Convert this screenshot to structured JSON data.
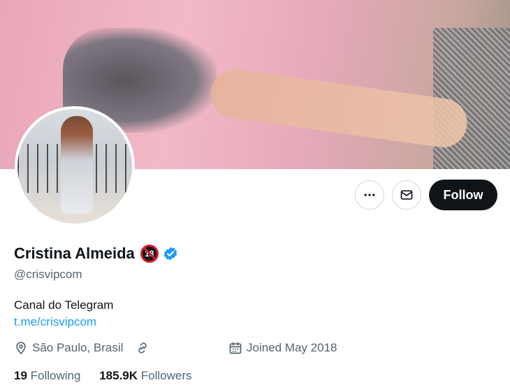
{
  "profile": {
    "display_name": "Cristina Almeida",
    "age_badge": "18",
    "handle": "@crisvipcom",
    "bio": "Canal do Telegram",
    "link": "t.me/crisvipcom",
    "location": "São Paulo, Brasil",
    "joined": "Joined May 2018",
    "following_count": "19",
    "following_label": "Following",
    "followers_count": "185.9K",
    "followers_label": "Followers"
  },
  "actions": {
    "follow_label": "Follow"
  },
  "icons": {
    "more": "more-horizontal-icon",
    "message": "envelope-icon",
    "verified": "verified-badge-icon",
    "location": "location-pin-icon",
    "link": "link-icon",
    "calendar": "calendar-icon"
  },
  "colors": {
    "accent": "#1d9bf0",
    "primary_text": "#0f1419",
    "secondary_text": "#536471",
    "follow_bg": "#0f1419",
    "badge_red": "#d21f2b"
  }
}
